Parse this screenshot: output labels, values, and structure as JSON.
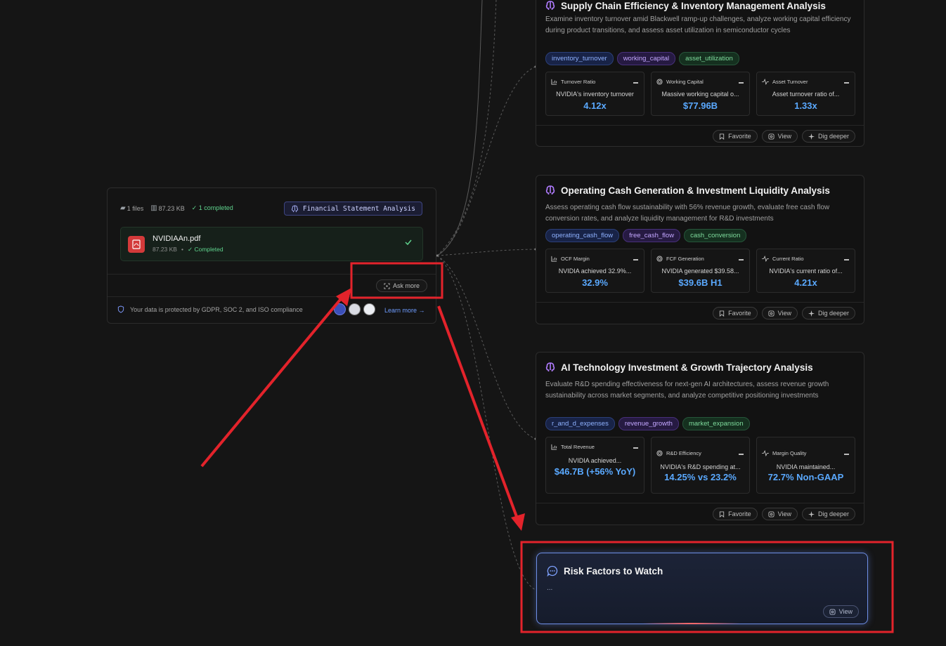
{
  "upload": {
    "files_count": "1 files",
    "size": "87.23 KB",
    "completed": "✓ 1 completed",
    "analysis_badge": "Financial Statement Analysis",
    "file": {
      "name": "NVIDIAAn.pdf",
      "size": "87.23 KB",
      "separator": "•",
      "status": "✓ Completed"
    },
    "ask_more": "Ask more",
    "compliance": "Your data is protected by GDPR, SOC 2, and ISO compliance",
    "learn_more": "Learn more →"
  },
  "cards": [
    {
      "title": "Supply Chain Efficiency & Inventory Management Analysis",
      "description": "Examine inventory turnover amid Blackwell ramp-up challenges, analyze working capital efficiency during product transitions, and assess asset utilization in semiconductor cycles",
      "tags": [
        "inventory_turnover",
        "working_capital",
        "asset_utilization"
      ],
      "metrics": [
        {
          "label": "Turnover Ratio",
          "icon": "bar-chart-icon",
          "desc": "NVIDIA's inventory turnover",
          "value": "4.12x"
        },
        {
          "label": "Working Capital",
          "icon": "target-icon",
          "desc": "Massive working capital o...",
          "value": "$77.96B"
        },
        {
          "label": "Asset Turnover",
          "icon": "pulse-icon",
          "desc": "Asset turnover ratio of...",
          "value": "1.33x"
        }
      ],
      "actions": [
        "Favorite",
        "View",
        "Dig deeper"
      ]
    },
    {
      "title": "Operating Cash Generation & Investment Liquidity Analysis",
      "description": "Assess operating cash flow sustainability with 56% revenue growth, evaluate free cash flow conversion rates, and analyze liquidity management for R&D investments",
      "tags": [
        "operating_cash_flow",
        "free_cash_flow",
        "cash_conversion"
      ],
      "metrics": [
        {
          "label": "OCF Margin",
          "icon": "bar-chart-icon",
          "desc": "NVIDIA achieved 32.9%...",
          "value": "32.9%"
        },
        {
          "label": "FCF Generation",
          "icon": "target-icon",
          "desc": "NVIDIA generated $39.58...",
          "value": "$39.6B H1"
        },
        {
          "label": "Current Ratio",
          "icon": "pulse-icon",
          "desc": "NVIDIA's current ratio of...",
          "value": "4.21x"
        }
      ],
      "actions": [
        "Favorite",
        "View",
        "Dig deeper"
      ]
    },
    {
      "title": "AI Technology Investment & Growth Trajectory Analysis",
      "description": "Evaluate R&D spending effectiveness for next-gen AI architectures, assess revenue growth sustainability across market segments, and analyze competitive positioning investments",
      "tags": [
        "r_and_d_expenses",
        "revenue_growth",
        "market_expansion"
      ],
      "metrics": [
        {
          "label": "Total Revenue",
          "icon": "bar-chart-icon",
          "desc": "NVIDIA achieved...",
          "value": "$46.7B (+56% YoY)"
        },
        {
          "label": "R&D Efficiency",
          "icon": "target-icon",
          "desc": "NVIDIA's R&D spending at...",
          "value": "14.25% vs 23.2%"
        },
        {
          "label": "Margin Quality",
          "icon": "pulse-icon",
          "desc": "NVIDIA maintained...",
          "value": "72.7% Non-GAAP"
        }
      ],
      "actions": [
        "Favorite",
        "View",
        "Dig deeper"
      ]
    }
  ],
  "risk": {
    "title": "Risk Factors to Watch",
    "ellipsis": "...",
    "view": "View"
  },
  "colors": {
    "background": "#151515",
    "metric_value": "#5aa9ff",
    "annotation_red": "#e3232b",
    "risk_border": "#6f8fe6"
  }
}
